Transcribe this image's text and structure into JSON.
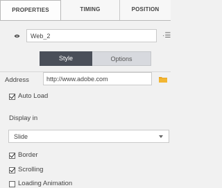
{
  "tabs": [
    {
      "label": "PROPERTIES",
      "active": true
    },
    {
      "label": "TIMING",
      "active": false
    },
    {
      "label": "POSITION",
      "active": false
    }
  ],
  "object": {
    "name": "Web_2",
    "visibility_icon": "eye-icon",
    "menu_icon": "menu-lines-icon"
  },
  "view_toggle": {
    "style_label": "Style",
    "options_label": "Options",
    "selected": "Style"
  },
  "address": {
    "label": "Address",
    "value": "http://www.adobe.com",
    "browse_icon": "folder-icon"
  },
  "auto_load": {
    "label": "Auto Load",
    "checked": true
  },
  "display_in": {
    "label": "Display in",
    "selected": "Slide"
  },
  "options": [
    {
      "label": "Border",
      "checked": true
    },
    {
      "label": "Scrolling",
      "checked": true
    },
    {
      "label": "Loading Animation",
      "checked": false
    }
  ],
  "colors": {
    "active_segment": "#4a4f59",
    "inactive_segment": "#d7d9de",
    "folder": "#e8a425"
  }
}
